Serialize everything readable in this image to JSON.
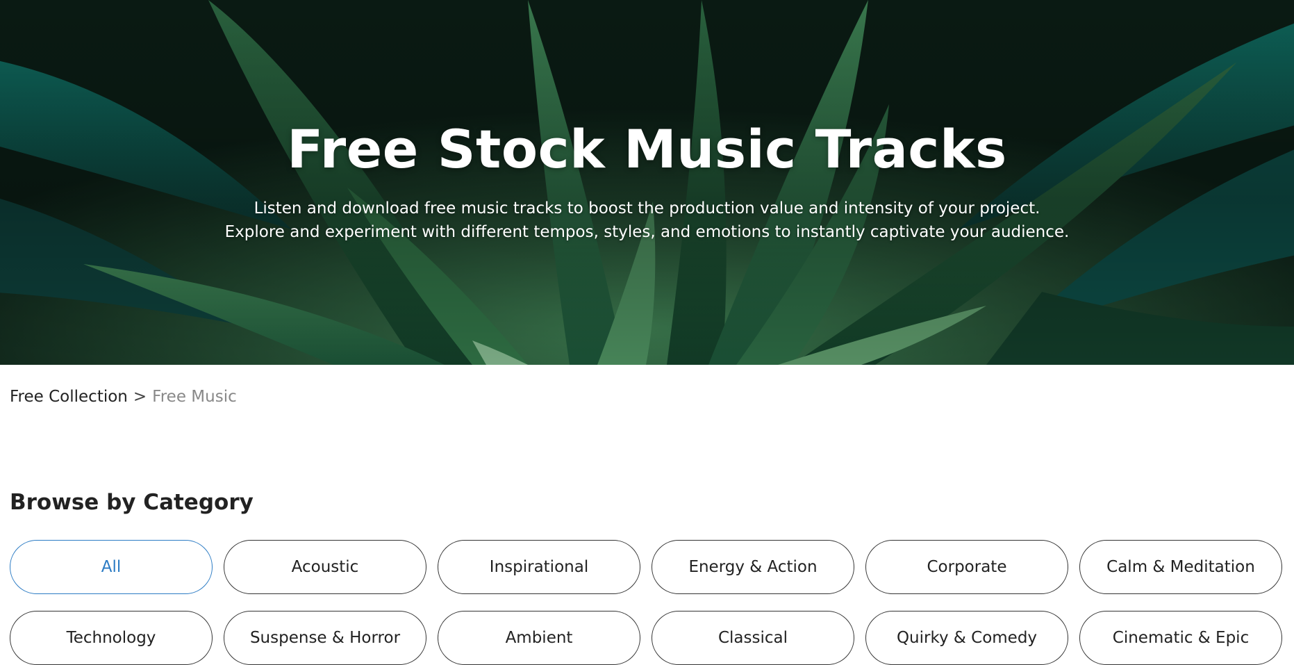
{
  "hero": {
    "title": "Free Stock Music Tracks",
    "subtitle_line1": "Listen and download free music tracks to boost the production value and intensity of your project.",
    "subtitle_line2": "Explore and experiment with different tempos, styles, and emotions to instantly captivate your audience."
  },
  "breadcrumb": {
    "parent": "Free Collection",
    "separator": ">",
    "current": "Free Music"
  },
  "section": {
    "title": "Browse by Category"
  },
  "categories": [
    {
      "label": "All",
      "active": true
    },
    {
      "label": "Acoustic",
      "active": false
    },
    {
      "label": "Inspirational",
      "active": false
    },
    {
      "label": "Energy & Action",
      "active": false
    },
    {
      "label": "Corporate",
      "active": false
    },
    {
      "label": "Calm & Meditation",
      "active": false
    },
    {
      "label": "Technology",
      "active": false
    },
    {
      "label": "Suspense & Horror",
      "active": false
    },
    {
      "label": "Ambient",
      "active": false
    },
    {
      "label": "Classical",
      "active": false
    },
    {
      "label": "Quirky & Comedy",
      "active": false
    },
    {
      "label": "Cinematic & Epic",
      "active": false
    }
  ],
  "colors": {
    "accent": "#2b7bc4",
    "chip_border": "#333333",
    "breadcrumb_current": "#888888"
  }
}
